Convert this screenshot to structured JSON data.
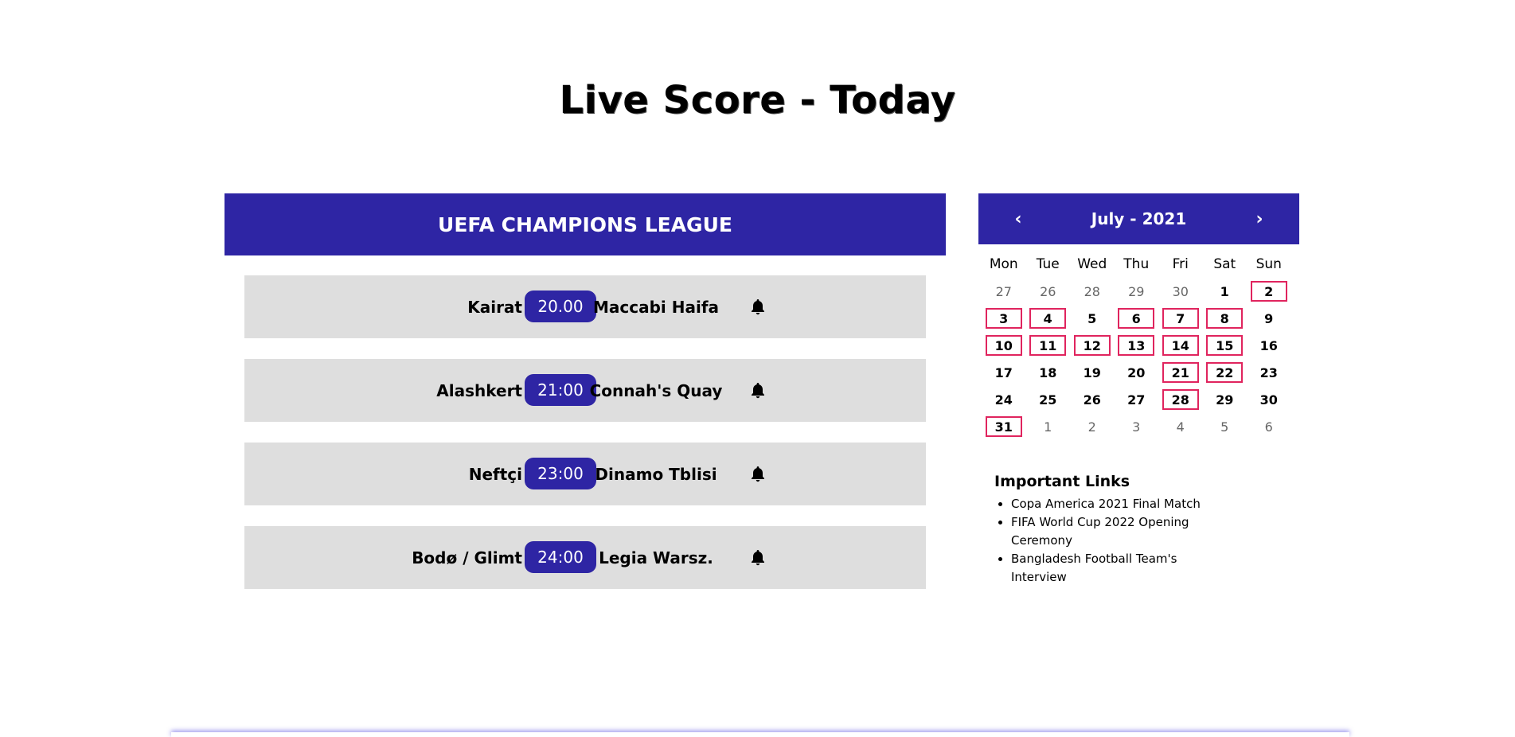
{
  "page": {
    "title": "Live Score - Today"
  },
  "league": {
    "name": "UEFA CHAMPIONS LEAGUE"
  },
  "matches": [
    {
      "home": "Kairat",
      "time": "20.00",
      "away": "Maccabi Haifa"
    },
    {
      "home": "Alashkert",
      "time": "21:00",
      "away": "Connah's Quay"
    },
    {
      "home": "Neftçi",
      "time": "23:00",
      "away": "Dinamo Tblisi"
    },
    {
      "home": "Bodø / Glimt",
      "time": "24:00",
      "away": "Legia Warsz."
    }
  ],
  "calendar": {
    "month_label": "July - 2021",
    "prev_icon": "chevron-left-icon",
    "next_icon": "chevron-right-icon",
    "weekdays": [
      "Mon",
      "Tue",
      "Wed",
      "Thu",
      "Fri",
      "Sat",
      "Sun"
    ],
    "days": [
      {
        "d": "27",
        "muted": true
      },
      {
        "d": "26",
        "muted": true
      },
      {
        "d": "28",
        "muted": true
      },
      {
        "d": "29",
        "muted": true
      },
      {
        "d": "30",
        "muted": true
      },
      {
        "d": "1"
      },
      {
        "d": "2",
        "marked": true
      },
      {
        "d": "3",
        "marked": true
      },
      {
        "d": "4",
        "marked": true
      },
      {
        "d": "5"
      },
      {
        "d": "6",
        "marked": true
      },
      {
        "d": "7",
        "marked": true
      },
      {
        "d": "8",
        "marked": true
      },
      {
        "d": "9"
      },
      {
        "d": "10",
        "marked": true
      },
      {
        "d": "11",
        "marked": true
      },
      {
        "d": "12",
        "marked": true
      },
      {
        "d": "13",
        "marked": true
      },
      {
        "d": "14",
        "marked": true
      },
      {
        "d": "15",
        "marked": true
      },
      {
        "d": "16"
      },
      {
        "d": "17"
      },
      {
        "d": "18"
      },
      {
        "d": "19"
      },
      {
        "d": "20"
      },
      {
        "d": "21",
        "marked": true
      },
      {
        "d": "22",
        "marked": true
      },
      {
        "d": "23"
      },
      {
        "d": "24"
      },
      {
        "d": "25"
      },
      {
        "d": "26"
      },
      {
        "d": "27"
      },
      {
        "d": "28",
        "marked": true
      },
      {
        "d": "29"
      },
      {
        "d": "30"
      },
      {
        "d": "31",
        "marked": true
      },
      {
        "d": "1",
        "muted": true
      },
      {
        "d": "2",
        "muted": true
      },
      {
        "d": "3",
        "muted": true
      },
      {
        "d": "4",
        "muted": true
      },
      {
        "d": "5",
        "muted": true
      },
      {
        "d": "6",
        "muted": true
      }
    ],
    "marked_color": "#e0245e"
  },
  "links": {
    "title": "Important Links",
    "items": [
      "Copa America 2021 Final Match",
      "FIFA World Cup 2022 Opening Ceremony",
      "Bangladesh Football Team's Interview"
    ]
  },
  "colors": {
    "accent": "#2e25a4",
    "row_bg": "#dedede"
  }
}
